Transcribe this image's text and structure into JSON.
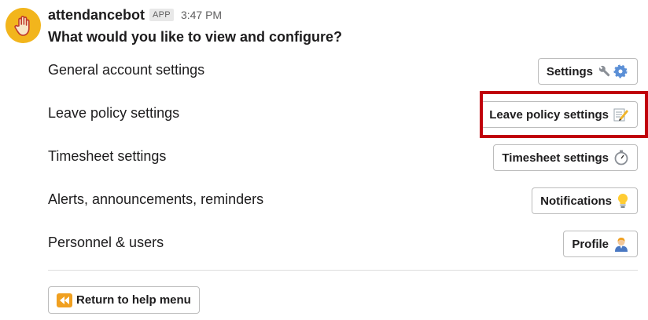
{
  "message": {
    "bot_name": "attendancebot",
    "badge": "APP",
    "time": "3:47 PM",
    "question": "What would you like to view and configure?",
    "avatar_icon": "raised-hand-icon",
    "avatar_color": "#f2b51c"
  },
  "rows": [
    {
      "label": "General account settings",
      "button": "Settings",
      "icon": "wrench-gear-icon"
    },
    {
      "label": "Leave policy settings",
      "button": "Leave policy settings",
      "icon": "memo-icon"
    },
    {
      "label": "Timesheet settings",
      "button": "Timesheet settings",
      "icon": "stopwatch-icon"
    },
    {
      "label": "Alerts, announcements, reminders",
      "button": "Notifications",
      "icon": "lightbulb-icon"
    },
    {
      "label": "Personnel & users",
      "button": "Profile",
      "icon": "office-worker-icon"
    }
  ],
  "footer": {
    "help_button": "Return to help menu",
    "help_icon": "rewind-icon"
  },
  "highlight_color": "#c0000a"
}
